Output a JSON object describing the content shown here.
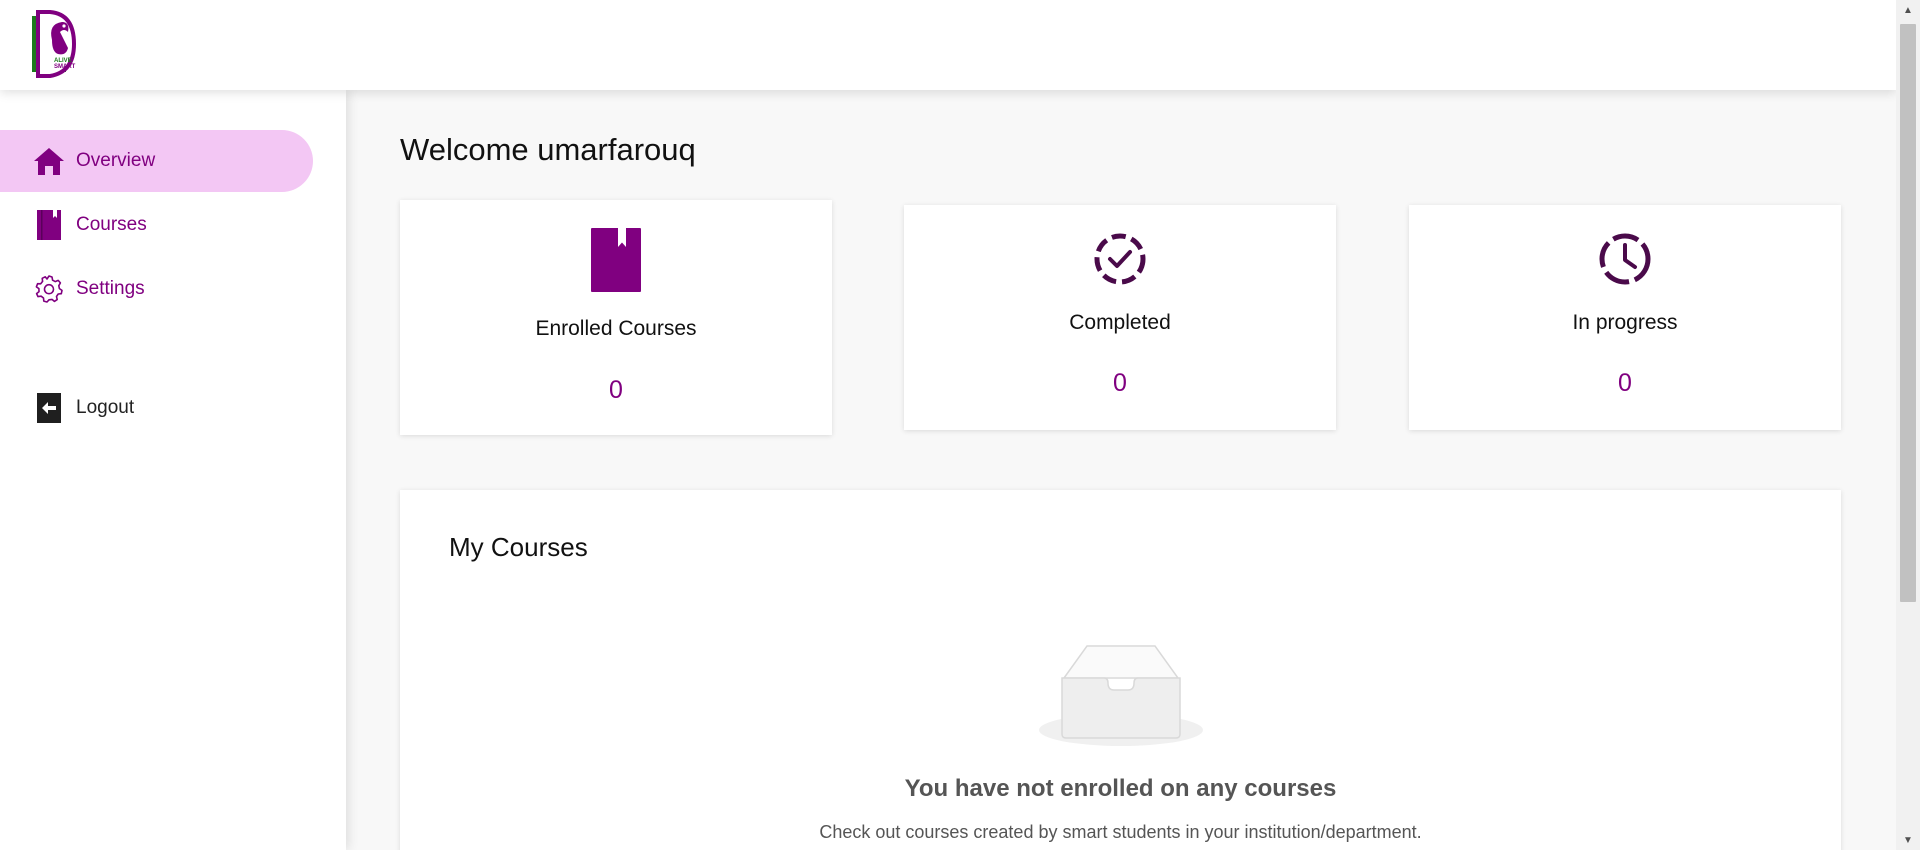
{
  "header": {
    "logo_icon": "squirrel-logo-icon"
  },
  "sidebar": {
    "items": [
      {
        "label": "Overview",
        "icon": "home-icon",
        "active": true
      },
      {
        "label": "Courses",
        "icon": "book-icon",
        "active": false
      },
      {
        "label": "Settings",
        "icon": "gear-icon",
        "active": false
      }
    ],
    "logout": {
      "label": "Logout",
      "icon": "logout-icon"
    }
  },
  "main": {
    "welcome": "Welcome umarfarouq",
    "stats": [
      {
        "label": "Enrolled Courses",
        "value": "0",
        "icon": "book-bookmark-icon"
      },
      {
        "label": "Completed",
        "value": "0",
        "icon": "check-circle-icon"
      },
      {
        "label": "In progress",
        "value": "0",
        "icon": "clock-icon"
      }
    ],
    "my_courses": {
      "title": "My Courses",
      "empty_icon": "empty-inbox-icon",
      "empty_title": "You have not enrolled on any courses",
      "empty_subtitle": "Check out courses created by smart students in your institution/department."
    }
  },
  "colors": {
    "accent": "#800080",
    "active_nav_bg": "#f3c7f4",
    "icon_dark_purple": "#4a0a4a",
    "logo_green": "#1b7a1b"
  }
}
